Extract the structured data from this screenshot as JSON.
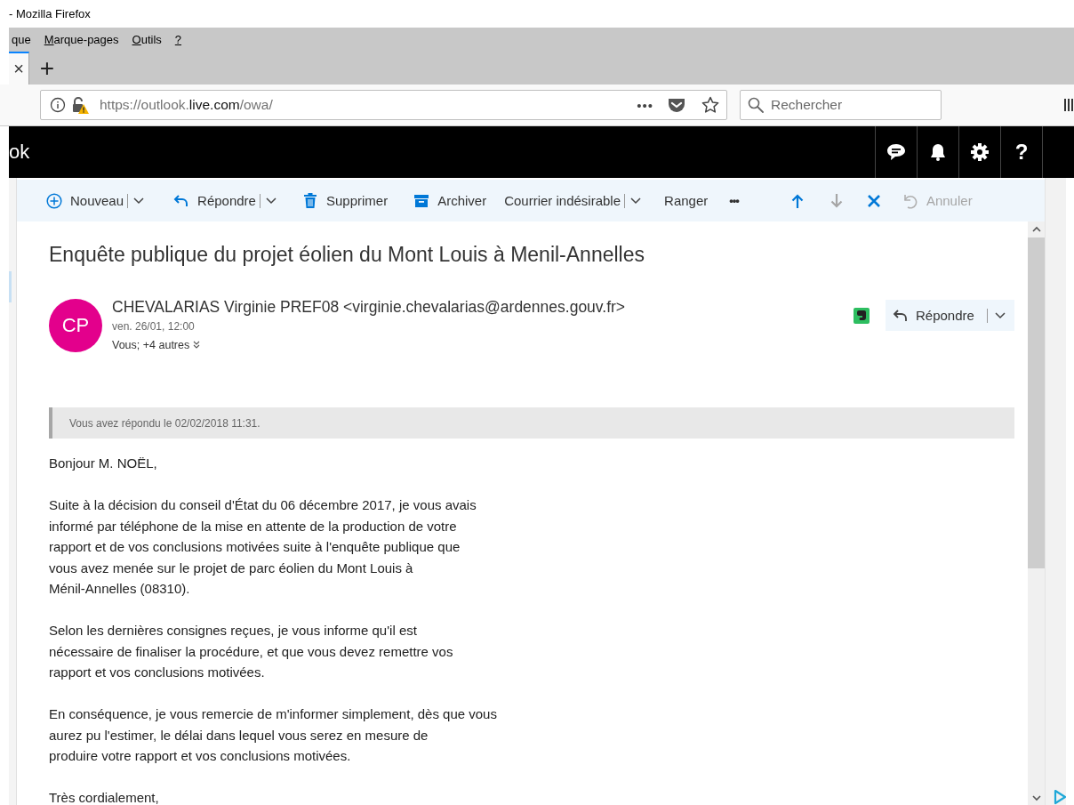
{
  "window": {
    "title": "- Mozilla Firefox"
  },
  "menu_bar": [
    {
      "label": "que",
      "accesskey": false
    },
    {
      "label": "Marque-pages",
      "accesskey": true
    },
    {
      "label": "Outils",
      "accesskey": true
    },
    {
      "label": "?",
      "accesskey": true
    }
  ],
  "tab_bar": {
    "close": "×",
    "new_tab": "+"
  },
  "address_bar": {
    "url_prefix": "https://outlook.",
    "url_domain": "live.com",
    "url_suffix": "/owa/",
    "page_actions": "•••"
  },
  "search": {
    "placeholder": "Rechercher"
  },
  "app_header": {
    "title": "ok",
    "help": "?"
  },
  "toolbar": [
    {
      "kind": "split",
      "label": "Nouveau",
      "disabled": false
    },
    {
      "kind": "split",
      "label": "Répondre",
      "disabled": false
    },
    {
      "kind": "plain",
      "label": "Supprimer",
      "disabled": false
    },
    {
      "kind": "plain",
      "label": "Archiver",
      "disabled": false
    },
    {
      "kind": "split",
      "label": "Courrier indésirable",
      "disabled": false
    },
    {
      "kind": "plain",
      "label": "Ranger",
      "disabled": false
    },
    {
      "kind": "more",
      "label": "•••",
      "disabled": false
    },
    {
      "kind": "icon",
      "disabled": false
    },
    {
      "kind": "icon",
      "disabled": true
    },
    {
      "kind": "icon",
      "disabled": false
    },
    {
      "kind": "plain",
      "label": "Annuler",
      "disabled": true
    }
  ],
  "message": {
    "subject": "Enquête publique du projet éolien du Mont Louis à Menil-Annelles",
    "avatar": {
      "initials": "CP",
      "color": "#e3008c"
    },
    "sender": "CHEVALARIAS Virginie PREF08 <virginie.chevalarias@ardennes.gouv.fr>",
    "date": "ven. 26/01, 12:00",
    "recipients": "Vous; +4 autres",
    "reply_button": "Répondre",
    "replied_notice": "Vous avez répondu le 02/02/2018 11:31.",
    "body": [
      {
        "lines": [
          "Bonjour M. NOËL,"
        ]
      },
      {
        "lines": [
          "Suite à la décision du conseil d'État du 06 décembre 2017, je vous avais",
          "informé par téléphone de la mise en attente de la production de votre",
          "rapport et de vos conclusions motivées suite à l'enquête publique que",
          "vous avez menée sur le projet de parc éolien du Mont Louis à",
          "Ménil-Annelles (08310)."
        ]
      },
      {
        "lines": [
          "Selon les dernières consignes reçues, je vous informe qu'il est",
          "nécessaire de finaliser la procédure, et que vous devez remettre vos",
          "rapport et vos conclusions motivées."
        ]
      },
      {
        "lines": [
          "En conséquence, je vous remercie de m'informer simplement, dès que vous",
          "aurez pu l'estimer, le délai dans lequel vous serez en mesure de",
          "produire votre rapport et vos conclusions motivées."
        ]
      },
      {
        "lines": [
          "Très cordialement,"
        ]
      }
    ]
  }
}
